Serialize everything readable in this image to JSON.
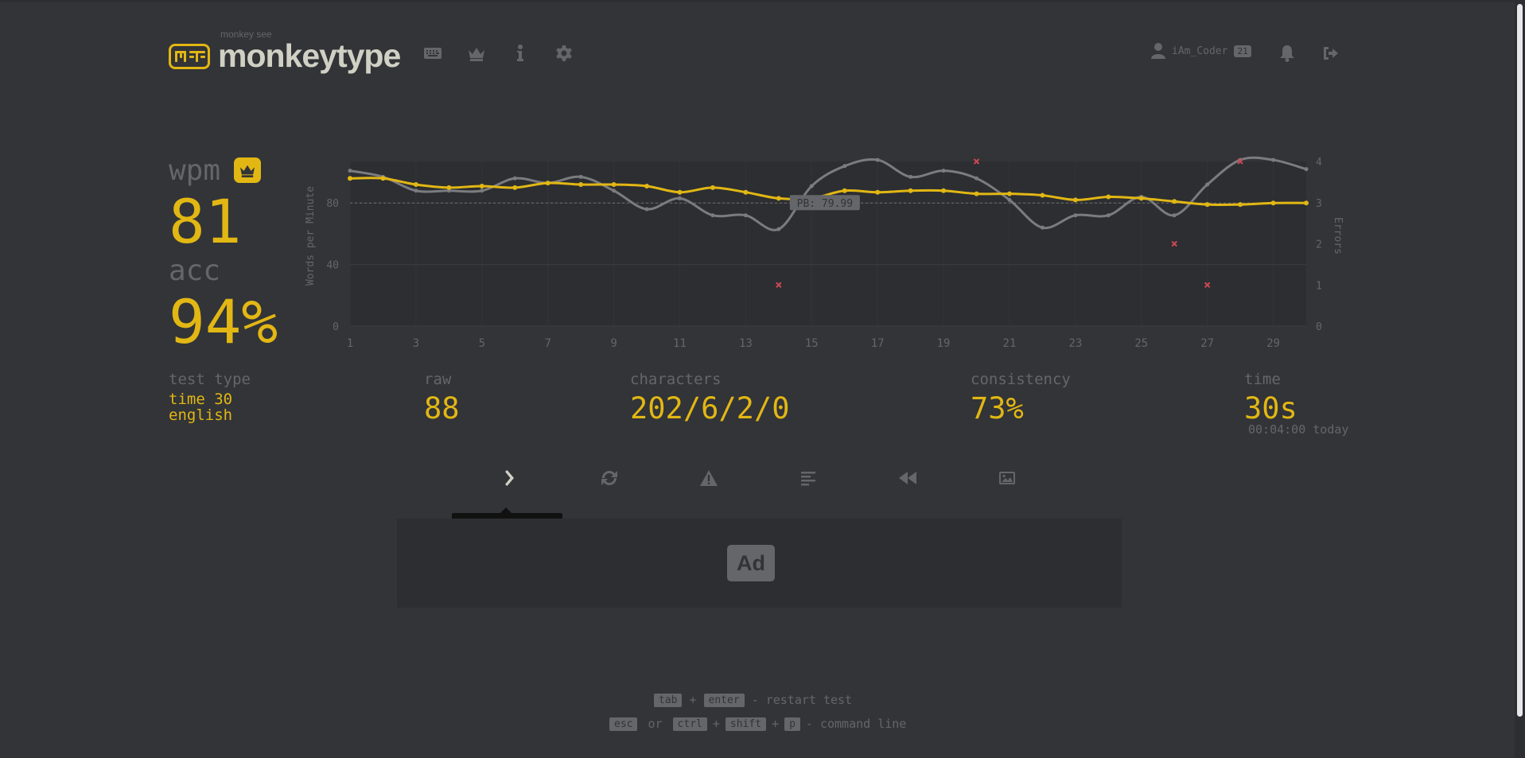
{
  "header": {
    "logo_subtitle": "monkey see",
    "logo_text": "monkeytype",
    "nav": [
      "keyboard-icon",
      "crown-icon",
      "info-icon",
      "gear-icon"
    ],
    "account": {
      "username": "iAm_Coder",
      "level": "21"
    }
  },
  "result": {
    "wpm_label": "wpm",
    "wpm": "81",
    "acc_label": "acc",
    "acc": "94%",
    "test_type_label": "test type",
    "test_type": "time 30",
    "language": "english",
    "raw_label": "raw",
    "raw": "88",
    "characters_label": "characters",
    "characters": "202/6/2/0",
    "consistency_label": "consistency",
    "consistency": "73%",
    "time_label": "time",
    "time": "30s",
    "time_detail": "00:04:00 today"
  },
  "buttons": {
    "next_test_tooltip": "Next test"
  },
  "ad": {
    "label": "Ad"
  },
  "footer": {
    "restart": {
      "key1": "tab",
      "plus": "+",
      "key2": "enter",
      "text": "- restart test"
    },
    "command": {
      "key1": "esc",
      "or": "or",
      "key2": "ctrl",
      "plus": "+",
      "key3": "shift",
      "key4": "p",
      "text": "- command line"
    }
  },
  "colors": {
    "accent": "#e2b714",
    "background": "#323437",
    "sub": "#646669",
    "text": "#d1d0c5",
    "error": "#ca4754"
  },
  "chart_data": {
    "type": "line",
    "ylabel": "Words per Minute",
    "y2label": "Errors",
    "x": [
      1,
      2,
      3,
      4,
      5,
      6,
      7,
      8,
      9,
      10,
      11,
      12,
      13,
      14,
      15,
      16,
      17,
      18,
      19,
      20,
      21,
      22,
      23,
      24,
      25,
      26,
      27,
      28,
      29,
      30
    ],
    "xticks": [
      "1",
      "3",
      "5",
      "7",
      "9",
      "11",
      "13",
      "15",
      "17",
      "19",
      "21",
      "23",
      "25",
      "27",
      "29"
    ],
    "ylim": [
      0,
      107
    ],
    "yticks": [
      "0",
      "40",
      "80"
    ],
    "y2lim": [
      0,
      4
    ],
    "y2ticks": [
      "0",
      "1",
      "2",
      "3",
      "4"
    ],
    "pb_label": "PB: 79.99",
    "pb_value": 80,
    "series": [
      {
        "values": [
          101,
          97,
          88,
          88,
          88,
          96,
          93,
          97,
          88,
          76,
          83,
          72,
          72,
          63,
          91,
          104,
          108,
          97,
          101,
          96,
          82,
          64,
          72,
          72,
          84,
          72,
          92,
          108,
          108,
          102
        ]
      },
      {
        "values": [
          96,
          96,
          92,
          90,
          91,
          90,
          93,
          92,
          92,
          91,
          87,
          90,
          87,
          83,
          83,
          88,
          87,
          88,
          88,
          86,
          86,
          85,
          82,
          84,
          83,
          81,
          79,
          79,
          80,
          80
        ]
      },
      {
        "name": "errors",
        "points": [
          [
            14,
            1
          ],
          [
            20,
            4
          ],
          [
            26,
            2
          ],
          [
            27,
            1
          ],
          [
            28,
            4
          ]
        ]
      }
    ],
    "grid": true
  }
}
